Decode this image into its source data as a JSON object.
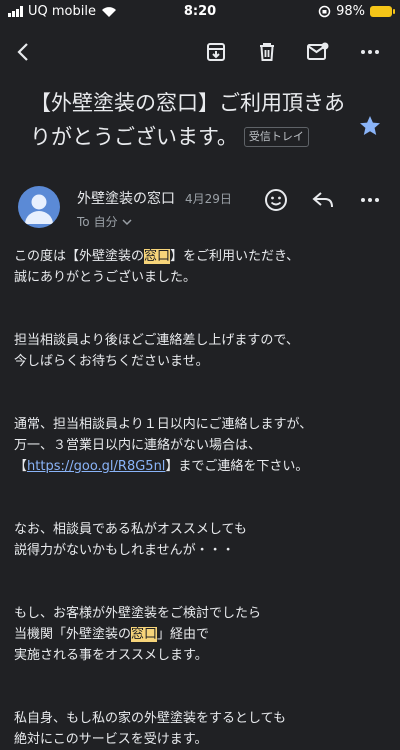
{
  "status": {
    "carrier": "UQ mobile",
    "time": "8:20",
    "battery": "98%"
  },
  "toolbar": {
    "icons": [
      "back-arrow-icon",
      "archive-icon",
      "trash-icon",
      "mark-unread-icon",
      "more-icon"
    ]
  },
  "email": {
    "subject": "【外壁塗装の窓口】ご利用頂きありがとうございます。",
    "label": "受信トレイ",
    "sender": "外壁塗装の窓口",
    "date": "4月29日",
    "to_prefix": "To",
    "to": "自分",
    "body": {
      "p1_a": "この度は【外壁塗装の",
      "p1_hl": "窓口",
      "p1_b": "】をご利用いただき、",
      "p1_line2": "誠にありがとうございました。",
      "p2_line1": "担当相談員より後ほどご連絡差し上げますので、",
      "p2_line2": "今しばらくお待ちくださいませ。",
      "p3_line1": "通常、担当相談員より１日以内にご連絡しますが、",
      "p3_line2": "万一、３営業日以内に連絡がない場合は、",
      "p3_bracket_open": "【",
      "p3_link": "https://goo.gl/R8G5nl",
      "p3_after": "】までご連絡を下さい。",
      "p4_line1": "なお、相談員である私がオススメしても",
      "p4_line2": "説得力がないかもしれませんが・・・",
      "p5_line1": "もし、お客様が外壁塗装をご検討でしたら",
      "p5_line2_a": "当機関「外壁塗装の",
      "p5_line2_hl": "窓口",
      "p5_line2_b": "」経由で",
      "p5_line3": "実施される事をオススメします。",
      "p6_line1": "私自身、もし私の家の外壁塗装をするとしても",
      "p6_line2": "絶対にこのサービスを受けます。"
    }
  },
  "colors": {
    "background": "#202124",
    "highlight": "#f6d47a",
    "link": "#8ab4f8",
    "star": "#8ab4f8",
    "avatar": "#5b8ad6",
    "battery": "#f5c518"
  }
}
